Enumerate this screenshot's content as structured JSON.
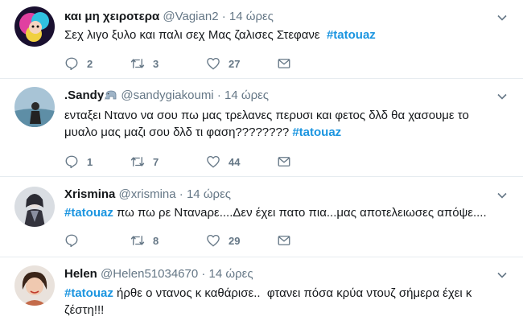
{
  "tweets": [
    {
      "name": "και μη χειροτερα",
      "handle": "@Vagian2",
      "separator": "·",
      "time": "14 ώρες",
      "text_before": "Σεχ λιγο ξυλο και παλι σεχ Μας ζαλισες Στεφανε  ",
      "hashtag": "#tatouaz",
      "text_after": "",
      "replies": "2",
      "retweets": "3",
      "likes": "27",
      "avatar_icon": "avatar-vagian2"
    },
    {
      "name": ".Sandy",
      "name_emoji": "elephant-emoji",
      "handle": "@sandygiakoumi",
      "separator": "·",
      "time": "14 ώρες",
      "text_before": "ενταξει Ντανο να σου πω μας τρελανες περυσι και φετος δλδ θα χασουμε το μυαλο μας μαζι σου δλδ τι φαση???????? ",
      "hashtag": "#tatouaz",
      "text_after": "",
      "replies": "1",
      "retweets": "7",
      "likes": "44",
      "avatar_icon": "avatar-sandy"
    },
    {
      "name": "Xrismina",
      "handle": "@xrismina",
      "separator": "·",
      "time": "14 ώρες",
      "text_before": "",
      "hashtag": "#tatouaz",
      "text_after": " πω πω ρε Ντανaρε....Δεν έχει πατο πια...μας αποτελειωσες απόψε....",
      "replies": "",
      "retweets": "8",
      "likes": "29",
      "avatar_icon": "avatar-xrismina"
    },
    {
      "name": "Helen",
      "handle": "@Helen51034670",
      "separator": "·",
      "time": "14 ώρες",
      "text_before": "",
      "hashtag": "#tatouaz",
      "text_after": " ήρθε ο ντανος κ καθάρισε..  φτανει πόσα κρύα ντουζ σήμερα έχει κ ζέστη!!!",
      "replies": "",
      "retweets": "",
      "likes": "",
      "avatar_icon": "avatar-helen"
    }
  ],
  "colors": {
    "hashtag": "#1b95e0",
    "secondary_text": "#657786",
    "icon": "#657786",
    "divider": "#e6ecf0"
  },
  "icons": [
    "reply-icon",
    "retweet-icon",
    "like-icon",
    "direct-message-icon",
    "caret-down-icon"
  ]
}
